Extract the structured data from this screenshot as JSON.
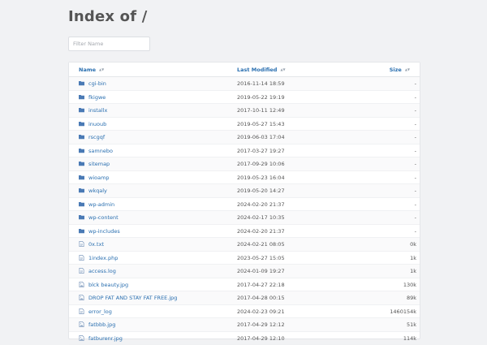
{
  "page": {
    "title": "Index of /"
  },
  "filter": {
    "placeholder": "Filter Name",
    "value": ""
  },
  "table": {
    "headers": {
      "name": "Name",
      "modified": "Last Modified",
      "size": "Size"
    },
    "rows": [
      {
        "name": "cgi-bin",
        "modified": "2016-11-14 18:59",
        "size": "-",
        "icon": "folder-icon"
      },
      {
        "name": "fkigwe",
        "modified": "2019-05-22 19:19",
        "size": "-",
        "icon": "folder-icon"
      },
      {
        "name": "installx",
        "modified": "2017-10-11 12:49",
        "size": "-",
        "icon": "folder-icon"
      },
      {
        "name": "inuoub",
        "modified": "2019-05-27 15:43",
        "size": "-",
        "icon": "folder-icon"
      },
      {
        "name": "rscgqf",
        "modified": "2019-06-03 17:04",
        "size": "-",
        "icon": "folder-icon"
      },
      {
        "name": "samnebo",
        "modified": "2017-03-27 19:27",
        "size": "-",
        "icon": "folder-icon"
      },
      {
        "name": "sitemap",
        "modified": "2017-09-29 10:06",
        "size": "-",
        "icon": "folder-icon"
      },
      {
        "name": "wioamp",
        "modified": "2019-05-23 16:04",
        "size": "-",
        "icon": "folder-icon"
      },
      {
        "name": "wkqaly",
        "modified": "2019-05-20 14:27",
        "size": "-",
        "icon": "folder-icon"
      },
      {
        "name": "wp-admin",
        "modified": "2024-02-20 21:37",
        "size": "-",
        "icon": "folder-icon"
      },
      {
        "name": "wp-content",
        "modified": "2024-02-17 10:35",
        "size": "-",
        "icon": "folder-icon"
      },
      {
        "name": "wp-includes",
        "modified": "2024-02-20 21:37",
        "size": "-",
        "icon": "folder-icon"
      },
      {
        "name": "0x.txt",
        "modified": "2024-02-21 08:05",
        "size": "0k",
        "icon": "file-icon"
      },
      {
        "name": "1index.php",
        "modified": "2023-05-27 15:05",
        "size": "1k",
        "icon": "file-icon"
      },
      {
        "name": "access.log",
        "modified": "2024-01-09 19:27",
        "size": "1k",
        "icon": "file-icon"
      },
      {
        "name": "blck beauty.jpg",
        "modified": "2017-04-27 22:18",
        "size": "130k",
        "icon": "image-file-icon"
      },
      {
        "name": "DROP FAT AND STAY FAT FREE.jpg",
        "modified": "2017-04-28 00:15",
        "size": "89k",
        "icon": "image-file-icon"
      },
      {
        "name": "error_log",
        "modified": "2024-02-23 09:21",
        "size": "1460154k",
        "icon": "file-icon"
      },
      {
        "name": "fatbbb.jpg",
        "modified": "2017-04-29 12:12",
        "size": "51k",
        "icon": "image-file-icon"
      },
      {
        "name": "fatburenr.jpg",
        "modified": "2017-04-29 12:10",
        "size": "114k",
        "icon": "image-file-icon"
      }
    ]
  },
  "colors": {
    "link": "#2a6fb0",
    "folder": "#4a7ab5",
    "background": "#f1f2f4"
  }
}
